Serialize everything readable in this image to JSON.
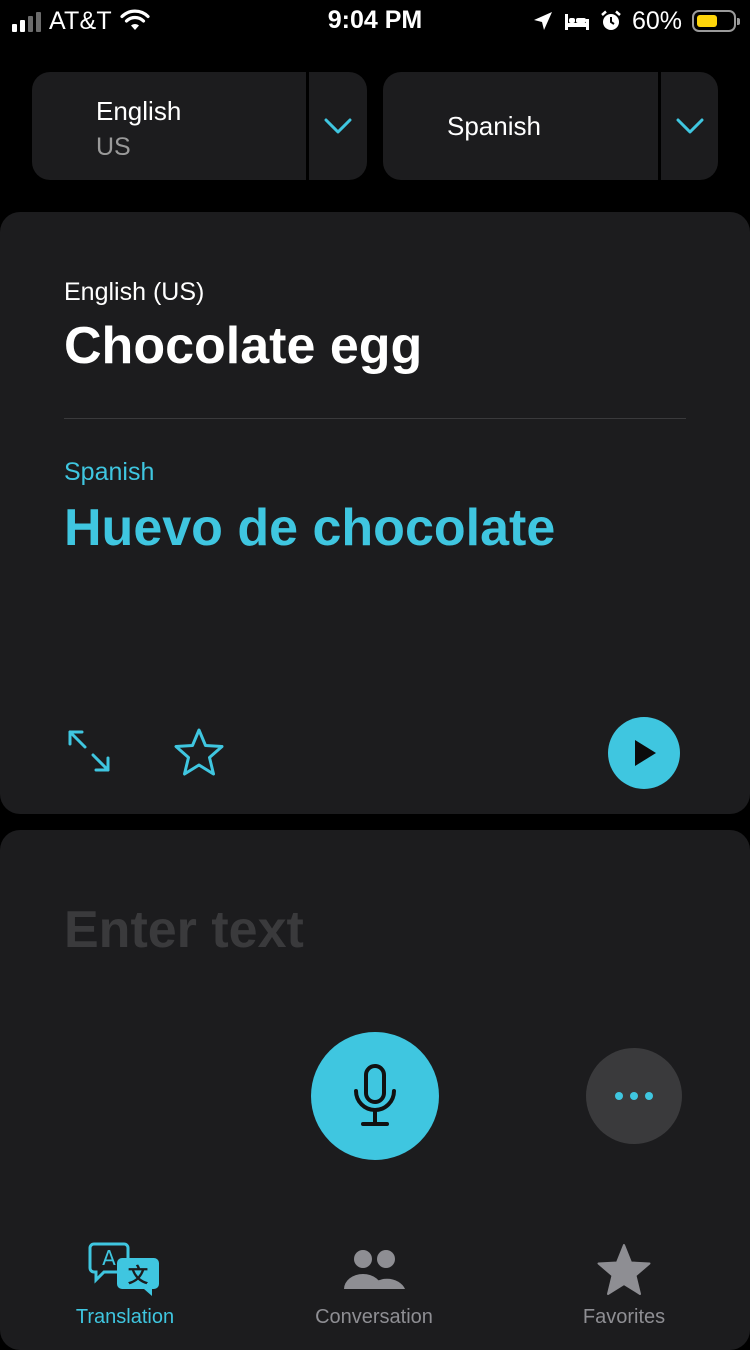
{
  "status_bar": {
    "carrier": "AT&T",
    "time": "9:04 PM",
    "battery_percent": "60%",
    "battery_level": 0.6,
    "battery_color": "#ffd60a",
    "icons": [
      "signal-icon",
      "wifi-icon",
      "location-icon",
      "sleep-bed-icon",
      "alarm-icon",
      "battery-icon"
    ]
  },
  "language_selector": {
    "source": {
      "name": "English",
      "region": "US"
    },
    "target": {
      "name": "Spanish"
    },
    "icon": "chevron-down-icon"
  },
  "translation_card": {
    "source_label": "English (US)",
    "source_text": "Chocolate egg",
    "target_label": "Spanish",
    "target_text": "Huevo de chocolate",
    "icons": [
      "expand-icon",
      "favorite-star-icon",
      "play-icon"
    ]
  },
  "input_card": {
    "placeholder": "Enter text",
    "icons": [
      "microphone-icon",
      "more-icon"
    ]
  },
  "tab_bar": {
    "tabs": [
      {
        "label": "Translation",
        "icon": "translation-icon",
        "active": true
      },
      {
        "label": "Conversation",
        "icon": "conversation-icon",
        "active": false
      },
      {
        "label": "Favorites",
        "icon": "favorites-star-icon",
        "active": false
      }
    ]
  },
  "colors": {
    "accent": "#3fc6e0",
    "background": "#000000",
    "card": "#1c1c1e",
    "inactive": "#8e8e93"
  }
}
